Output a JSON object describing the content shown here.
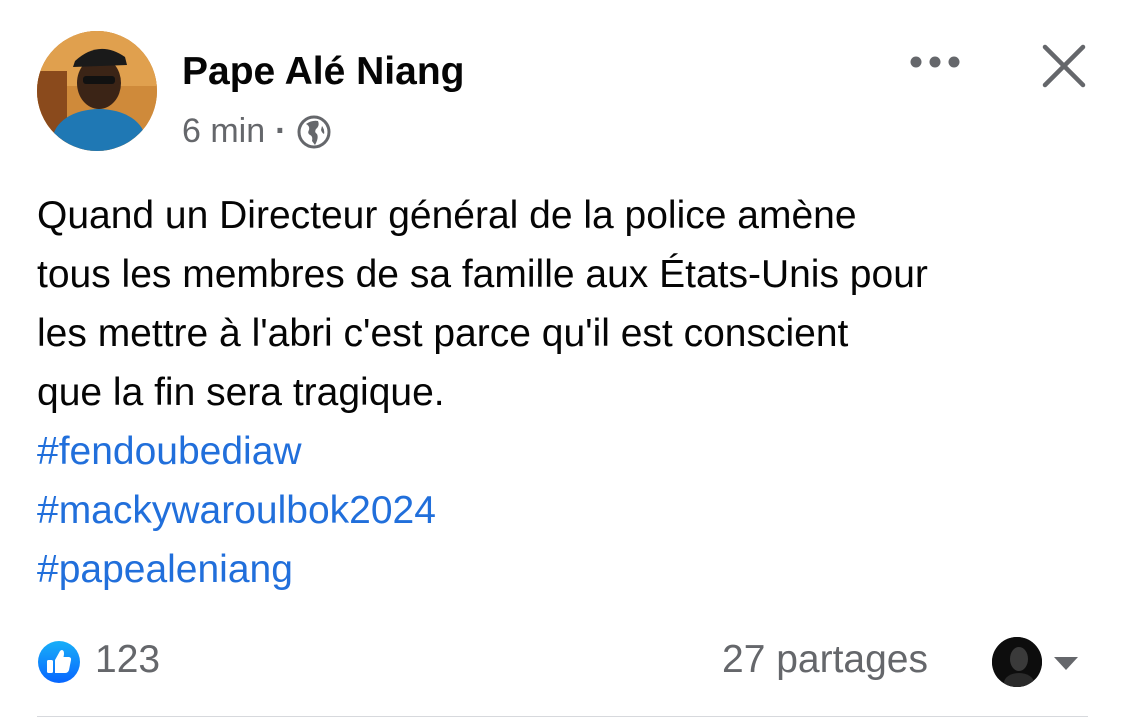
{
  "author": {
    "name": "Pape Alé Niang",
    "avatar_icon": "profile-photo"
  },
  "meta": {
    "time": "6 min",
    "separator": "·",
    "audience_icon": "globe-icon"
  },
  "actions": {
    "more_icon": "more-options-icon",
    "close_icon": "close-icon"
  },
  "post": {
    "text": "Quand un Directeur général de la police amène\ntous les membres de sa famille aux États-Unis pour\nles mettre à  l'abri c'est parce qu'il est conscient\nque la fin sera tragique.",
    "hashtags": [
      "#fendoubediaw",
      "#mackywaroulbok2024",
      "#papealeniang"
    ]
  },
  "footer": {
    "reaction_icon": "like-icon",
    "reaction_count": "123",
    "shares": "27 partages",
    "shares_avatar_icon": "sharer-avatar",
    "caret_icon": "caret-down-icon"
  },
  "colors": {
    "hashtag": "#216fdb",
    "secondary_text": "#65676b",
    "like_blue": "#1877f2"
  }
}
